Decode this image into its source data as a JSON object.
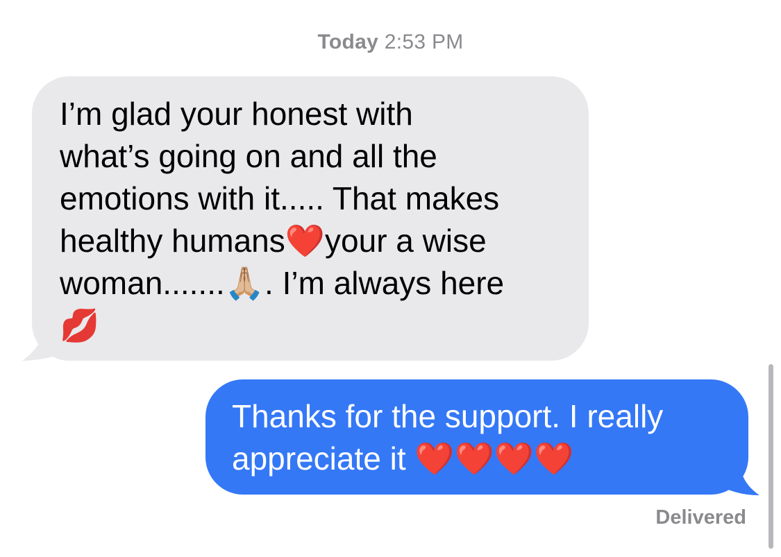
{
  "conversation": {
    "timestamp_day": "Today",
    "timestamp_time": "2:53 PM"
  },
  "messages": [
    {
      "direction": "incoming",
      "text": "I’m glad your honest with\nwhat’s going on and all the\nemotions with it.....  That makes\nhealthy humans❤️your a wise\nwoman.......🙏🏼.  I’m always here\n💋"
    },
    {
      "direction": "outgoing",
      "text": "Thanks for the support. I really\nappreciate it ❤️❤️❤️❤️"
    }
  ],
  "status": {
    "label": "Delivered"
  },
  "colors": {
    "incoming_bubble": "#e9e9eb",
    "outgoing_bubble": "#3478f6",
    "meta_text": "#8a8a8e"
  }
}
